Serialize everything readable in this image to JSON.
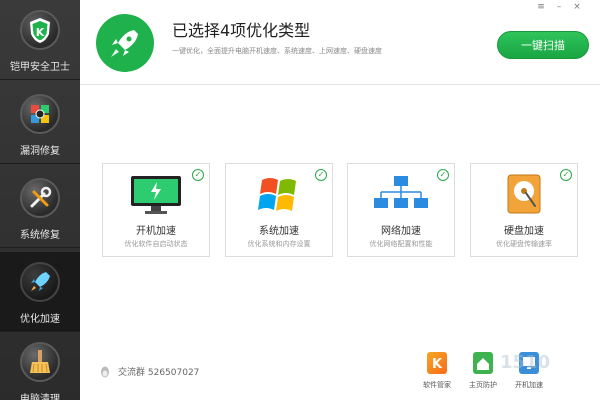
{
  "window": {
    "controls": [
      "≡",
      "–",
      "×"
    ]
  },
  "sidebar": {
    "items": [
      {
        "label": "铠甲安全卫士",
        "icon": "shield-k-icon"
      },
      {
        "label": "漏洞修复",
        "icon": "windows-flag-icon"
      },
      {
        "label": "系统修复",
        "icon": "wrench-screwdriver-icon"
      },
      {
        "label": "优化加速",
        "icon": "rocket-icon"
      },
      {
        "label": "电脑清理",
        "icon": "broom-icon"
      }
    ],
    "active_index": 3
  },
  "header": {
    "icon": "rocket-icon",
    "title": "已选择4项优化类型",
    "subtitle": "一键优化，全面提升电脑开机速度、系统速度、上网速度、硬盘速度",
    "scan_button": "一键扫描"
  },
  "cards": [
    {
      "title": "开机加速",
      "subtitle": "优化软件自启动状态",
      "icon": "monitor-bolt-icon",
      "checked": true
    },
    {
      "title": "系统加速",
      "subtitle": "优化系统和内存设置",
      "icon": "windows-logo-icon",
      "checked": true
    },
    {
      "title": "网络加速",
      "subtitle": "优化网络配置和性能",
      "icon": "network-tree-icon",
      "checked": true
    },
    {
      "title": "硬盘加速",
      "subtitle": "优化硬盘传输速率",
      "icon": "hard-disk-icon",
      "checked": true
    }
  ],
  "footer": {
    "qq_group_label": "交流群 526507027",
    "tools": [
      {
        "label": "软件管家",
        "icon": "k-app-icon",
        "color": "#f5a623"
      },
      {
        "label": "主页防护",
        "icon": "home-shield-icon",
        "color": "#3fb34f"
      },
      {
        "label": "开机加速",
        "icon": "boot-speed-icon",
        "color": "#3a8fd8"
      }
    ]
  },
  "colors": {
    "accent": "#1fb24c",
    "sidebar_bg": "#2f2f2f",
    "check": "#2aa84a"
  }
}
